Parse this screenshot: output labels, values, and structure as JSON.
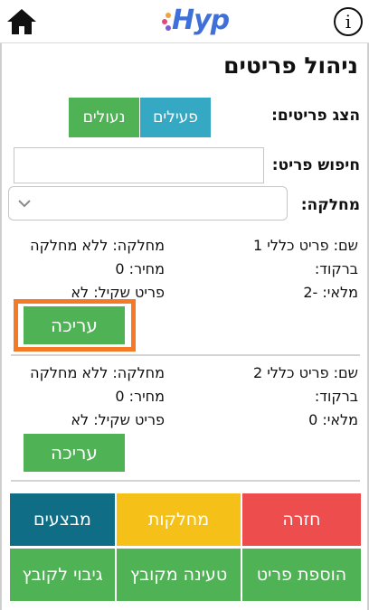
{
  "header": {
    "logo_text": "Hyp",
    "info_glyph": "i",
    "home_icon": "home-icon",
    "brand_color": "#3f6fd8"
  },
  "page": {
    "title": "ניהול פריטים"
  },
  "filter": {
    "label": "הצג פריטים:",
    "active_label": "פעילים",
    "inactive_label": "נעולים"
  },
  "search": {
    "label": "חיפוש פריט:",
    "value": ""
  },
  "category": {
    "label": "מחלקה:",
    "selected": ""
  },
  "items": [
    {
      "name": "שם: פריט כללי 1",
      "category": "מחלקה: ללא מחלקה",
      "barcode": "ברקוד:",
      "price": "מחיר: 0",
      "stock": "מלאי: -2",
      "weighable": "פריט שקיל: לא",
      "edit_label": "עריכה"
    },
    {
      "name": "שם: פריט כללי 2",
      "category": "מחלקה: ללא מחלקה",
      "barcode": "ברקוד:",
      "price": "מחיר: 0",
      "stock": "מלאי: 0",
      "weighable": "פריט שקיל: לא",
      "edit_label": "עריכה"
    }
  ],
  "actions": {
    "back": "חזרה",
    "departments": "מחלקות",
    "promotions": "מבצעים",
    "add_item": "הוספת פריט",
    "load_file": "טעינה מקובץ",
    "backup_file": "גיבוי לקובץ"
  },
  "colors": {
    "cyan": "#35a9c4",
    "green": "#4fb355",
    "red": "#ee4d4e",
    "yellow": "#f5c118",
    "teal": "#0f6d86",
    "highlight": "#f47a25"
  }
}
